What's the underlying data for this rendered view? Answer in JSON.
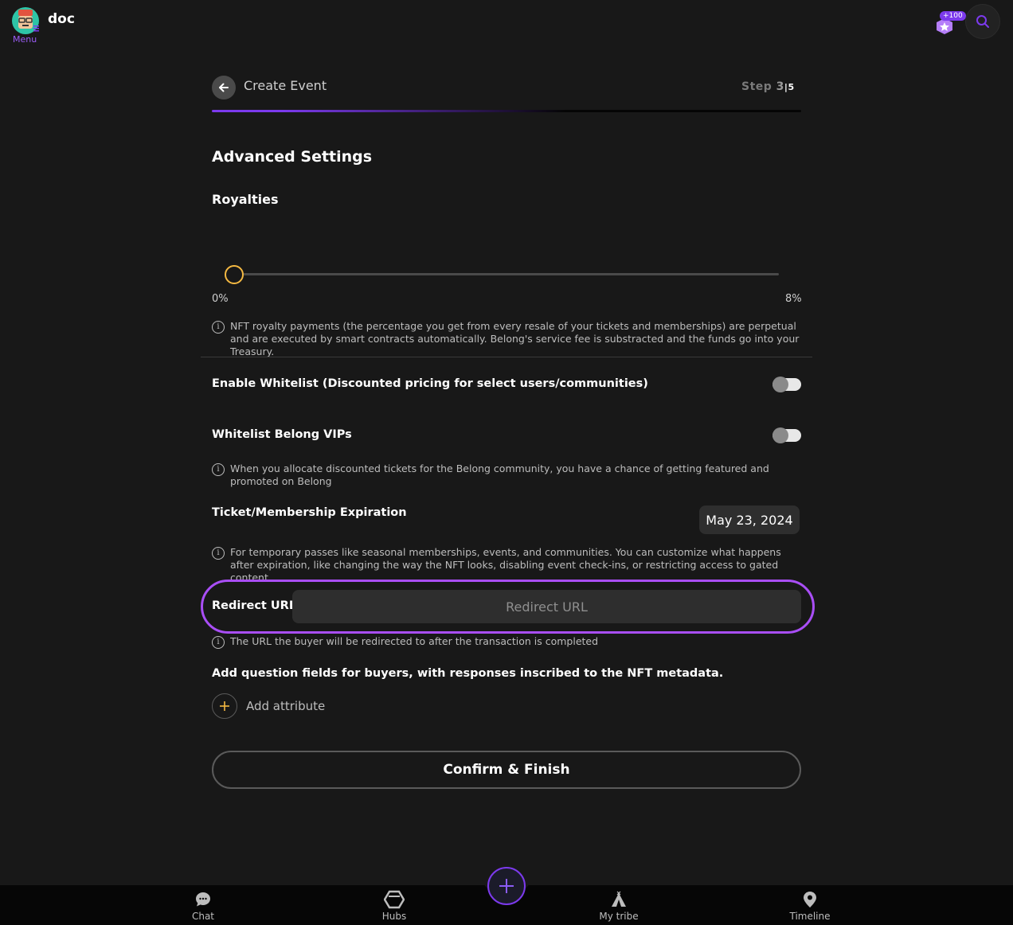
{
  "header": {
    "username": "doc",
    "menu_label": "Menu",
    "points_badge": "+100"
  },
  "wizard": {
    "title": "Create Event",
    "step_prefix": "Step",
    "step_current": "3",
    "step_separator": "|",
    "step_total": "5",
    "progress_fraction": 0.6
  },
  "advanced": {
    "section_title": "Advanced Settings",
    "royalties_title": "Royalties",
    "slider_min_label": "0%",
    "slider_max_label": "8%",
    "royalty_value_percent": 0,
    "royalty_info": "NFT royalty payments (the percentage you get from every resale of your tickets and memberships) are perpetual and are executed by smart contracts automatically. Belong's service fee is substracted and the funds go into your Treasury.",
    "whitelist_label": "Enable Whitelist (Discounted pricing for select users/communities)",
    "whitelist_enabled": false,
    "vip_label": "Whitelist Belong VIPs",
    "vip_enabled": false,
    "vip_info": "When you allocate discounted tickets for the Belong community, you have a chance of getting featured and promoted on Belong",
    "expiration_label": "Ticket/Membership Expiration",
    "expiration_date": "May 23, 2024",
    "expiration_info": "For temporary passes like seasonal memberships, events, and communities. You can customize what happens after expiration, like changing the way the NFT looks, disabling event check-ins, or restricting access to gated content.",
    "redirect_label": "Redirect URL",
    "redirect_placeholder": "Redirect URL",
    "redirect_value": "",
    "redirect_info": "The URL the buyer will be redirected to after the transaction is completed",
    "questions_title": "Add question fields for buyers, with responses inscribed to the NFT metadata.",
    "add_attribute_label": "Add attribute",
    "confirm_label": "Confirm & Finish"
  },
  "bottom_nav": {
    "chat": "Chat",
    "hubs": "Hubs",
    "my_tribe": "My tribe",
    "timeline": "Timeline"
  },
  "colors": {
    "accent": "#7c3aed",
    "highlight_ring": "#a94ef6",
    "slider_thumb": "#f5b942",
    "background": "#181818"
  },
  "icons": {
    "avatar": "robot-avatar",
    "points": "star-badge-icon",
    "search": "search-icon",
    "back": "arrow-left-icon",
    "info": "info-icon",
    "add": "plus-icon",
    "chat": "chat-bubble-icon",
    "hubs": "hexagon-icon",
    "fab": "plus-icon",
    "tribe": "tent-icon",
    "timeline": "map-pin-icon"
  }
}
